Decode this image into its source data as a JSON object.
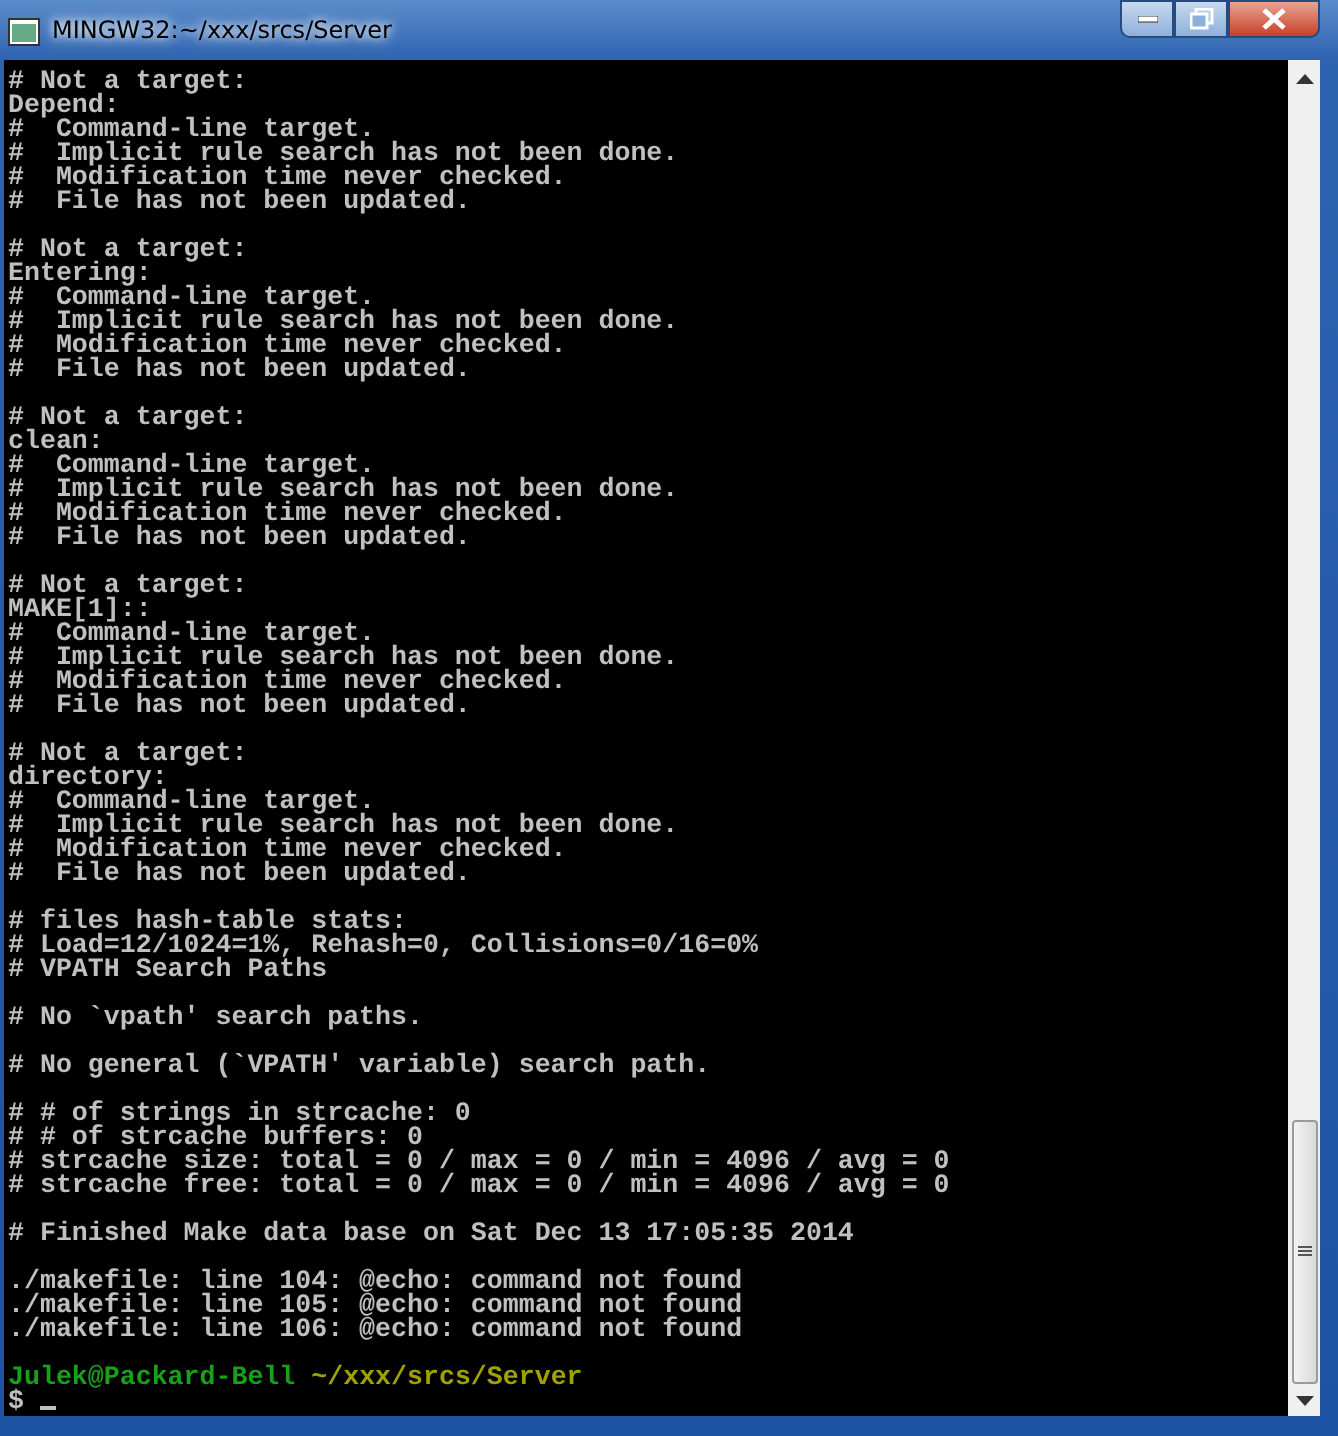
{
  "window": {
    "title": "MINGW32:~/xxx/srcs/Server"
  },
  "terminal": {
    "blocks": [
      [
        "# Not a target:",
        "Depend:",
        "#  Command-line target.",
        "#  Implicit rule search has not been done.",
        "#  Modification time never checked.",
        "#  File has not been updated."
      ],
      [
        "# Not a target:",
        "Entering:",
        "#  Command-line target.",
        "#  Implicit rule search has not been done.",
        "#  Modification time never checked.",
        "#  File has not been updated."
      ],
      [
        "# Not a target:",
        "clean:",
        "#  Command-line target.",
        "#  Implicit rule search has not been done.",
        "#  Modification time never checked.",
        "#  File has not been updated."
      ],
      [
        "# Not a target:",
        "MAKE[1]::",
        "#  Command-line target.",
        "#  Implicit rule search has not been done.",
        "#  Modification time never checked.",
        "#  File has not been updated."
      ],
      [
        "# Not a target:",
        "directory:",
        "#  Command-line target.",
        "#  Implicit rule search has not been done.",
        "#  Modification time never checked.",
        "#  File has not been updated."
      ],
      [
        "# files hash-table stats:",
        "# Load=12/1024=1%, Rehash=0, Collisions=0/16=0%",
        "# VPATH Search Paths"
      ],
      [
        "# No `vpath' search paths."
      ],
      [
        "# No general (`VPATH' variable) search path."
      ],
      [
        "# # of strings in strcache: 0",
        "# # of strcache buffers: 0",
        "# strcache size: total = 0 / max = 0 / min = 4096 / avg = 0",
        "# strcache free: total = 0 / max = 0 / min = 4096 / avg = 0"
      ],
      [
        "# Finished Make data base on Sat Dec 13 17:05:35 2014"
      ],
      [
        "./makefile: line 104: @echo: command not found",
        "./makefile: line 105: @echo: command not found",
        "./makefile: line 106: @echo: command not found"
      ]
    ],
    "prompt": {
      "user_host": "Julek@Packard-Bell",
      "path": "~/xxx/srcs/Server",
      "symbol": "$"
    }
  }
}
